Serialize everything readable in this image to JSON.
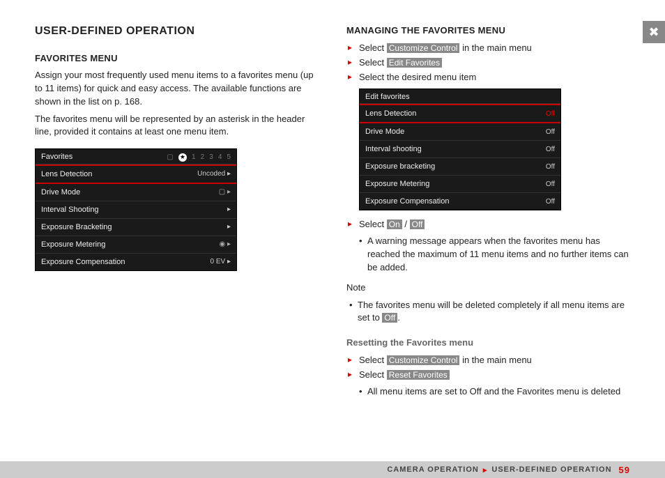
{
  "header": {
    "title": "USER-DEFINED OPERATION"
  },
  "left": {
    "h2": "FAVORITES MENU",
    "p1": "Assign your most frequently used menu items to a favorites menu (up to 11 items) for quick and easy access. The available functions are shown in the list on p. 168.",
    "p2": "The favorites menu will be represented by an asterisk in the header line, provided it contains at least one menu item."
  },
  "cam1": {
    "title": "Favorites",
    "tabs": [
      "1",
      "2",
      "3",
      "4",
      "5"
    ],
    "rows": [
      {
        "label": "Lens Detection",
        "val": "Uncoded ▸",
        "sel": true
      },
      {
        "label": "Drive Mode",
        "val": "▢ ▸"
      },
      {
        "label": "Interval Shooting",
        "val": "▸"
      },
      {
        "label": "Exposure Bracketing",
        "val": "▸"
      },
      {
        "label": "Exposure Metering",
        "val": "◉ ▸"
      },
      {
        "label": "Exposure Compensation",
        "val": "0 EV ▸"
      }
    ]
  },
  "right": {
    "h2": "MANAGING THE FAVORITES MENU",
    "step1_pre": "Select ",
    "step1_tag": "Customize Control",
    "step1_post": " in the main menu",
    "step2_pre": "Select ",
    "step2_tag": "Edit Favorites",
    "step3": "Select the desired menu item",
    "step4_pre": "Select ",
    "step4_tag1": "On",
    "step4_sep": " / ",
    "step4_tag2": "Off",
    "bullet1": "A warning message appears when the favorites menu has reached the maximum of 11 menu items and no further items can be added.",
    "note_label": "Note",
    "note_text_pre": "The favorites menu will be deleted completely if all menu items are set to ",
    "note_tag": "Off",
    "note_text_post": ".",
    "h3": "Resetting the Favorites menu",
    "r_step1_pre": "Select ",
    "r_step1_tag": "Customize Control",
    "r_step1_post": " in the main menu",
    "r_step2_pre": "Select ",
    "r_step2_tag": "Reset Favorites",
    "r_bullet": "All menu items are set to Off and the Favorites menu is deleted"
  },
  "cam2": {
    "title": "Edit favorites",
    "rows": [
      {
        "label": "Lens Detection",
        "val": "Off",
        "sel": true,
        "red": true
      },
      {
        "label": "Drive Mode",
        "val": "Off"
      },
      {
        "label": "Interval shooting",
        "val": "Off"
      },
      {
        "label": "Exposure bracketing",
        "val": "Off"
      },
      {
        "label": "Exposure Metering",
        "val": "Off"
      },
      {
        "label": "Exposure Compensation",
        "val": "Off"
      }
    ]
  },
  "footer": {
    "crumb1": "CAMERA OPERATION",
    "crumb2": "USER-DEFINED OPERATION",
    "page": "59"
  },
  "thumb": "✖"
}
